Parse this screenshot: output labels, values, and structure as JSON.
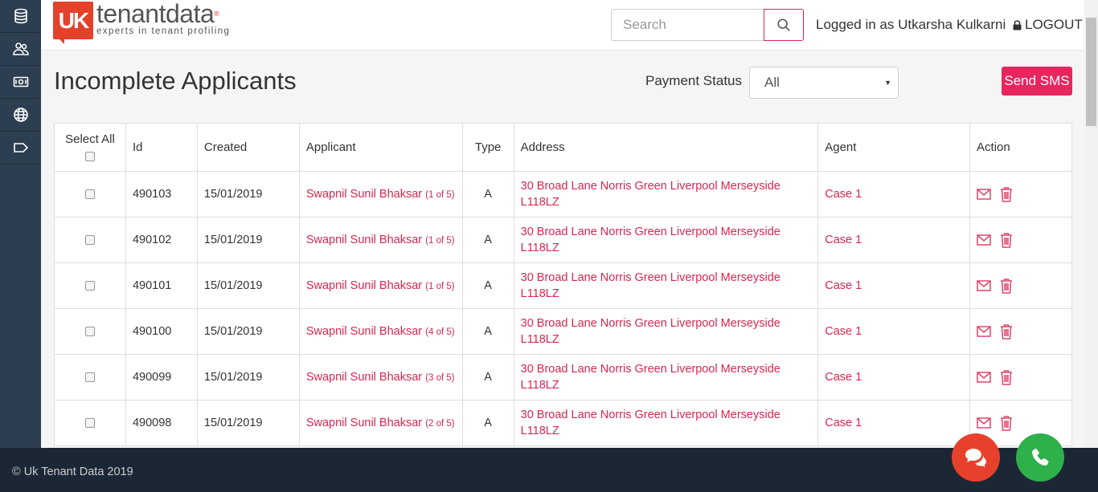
{
  "sidebar": {
    "items": [
      {
        "icon": "database-icon"
      },
      {
        "icon": "users-icon"
      },
      {
        "icon": "money-icon"
      },
      {
        "icon": "globe-icon"
      },
      {
        "icon": "tag-icon"
      }
    ]
  },
  "header": {
    "logo_mark": "UK",
    "logo_name": "tenantdata",
    "logo_reg": "®",
    "logo_tagline": "experts in tenant profiling",
    "search_placeholder": "Search",
    "login_text": "Logged in as Utkarsha Kulkarni",
    "logout_label": "LOGOUT"
  },
  "page": {
    "title": "Incomplete Applicants",
    "payment_status_label": "Payment Status",
    "payment_status_value": "All",
    "send_sms_label": "Send SMS"
  },
  "table": {
    "headers": {
      "select_all": "Select All",
      "id": "Id",
      "created": "Created",
      "applicant": "Applicant",
      "type": "Type",
      "address": "Address",
      "agent": "Agent",
      "action": "Action"
    },
    "rows": [
      {
        "id": "490103",
        "created": "15/01/2019",
        "applicant": "Swapnil Sunil Bhaksar",
        "of": "(1 of 5)",
        "type": "A",
        "address_line1": "30 Broad Lane Norris Green Liverpool Merseyside",
        "address_line2": "L118LZ",
        "agent": "Case 1"
      },
      {
        "id": "490102",
        "created": "15/01/2019",
        "applicant": "Swapnil Sunil Bhaksar",
        "of": "(1 of 5)",
        "type": "A",
        "address_line1": "30 Broad Lane Norris Green Liverpool Merseyside",
        "address_line2": "L118LZ",
        "agent": "Case 1"
      },
      {
        "id": "490101",
        "created": "15/01/2019",
        "applicant": "Swapnil Sunil Bhaksar",
        "of": "(1 of 5)",
        "type": "A",
        "address_line1": "30 Broad Lane Norris Green Liverpool Merseyside",
        "address_line2": "L118LZ",
        "agent": "Case 1"
      },
      {
        "id": "490100",
        "created": "15/01/2019",
        "applicant": "Swapnil Sunil Bhaksar",
        "of": "(4 of 5)",
        "type": "A",
        "address_line1": "30 Broad Lane Norris Green Liverpool Merseyside",
        "address_line2": "L118LZ",
        "agent": "Case 1"
      },
      {
        "id": "490099",
        "created": "15/01/2019",
        "applicant": "Swapnil Sunil Bhaksar",
        "of": "(3 of 5)",
        "type": "A",
        "address_line1": "30 Broad Lane Norris Green Liverpool Merseyside",
        "address_line2": "L118LZ",
        "agent": "Case 1"
      },
      {
        "id": "490098",
        "created": "15/01/2019",
        "applicant": "Swapnil Sunil Bhaksar",
        "of": "(2 of 5)",
        "type": "A",
        "address_line1": "30 Broad Lane Norris Green Liverpool Merseyside",
        "address_line2": "L118LZ",
        "agent": "Case 1"
      }
    ]
  },
  "footer": {
    "copyright": "© Uk Tenant Data 2019"
  },
  "colors": {
    "accent": "#e8265e",
    "link": "#d9264f",
    "sidebar": "#2c3e50",
    "footer": "#1c2735",
    "chat_button": "#e8412b",
    "phone_button": "#2eb04b"
  }
}
